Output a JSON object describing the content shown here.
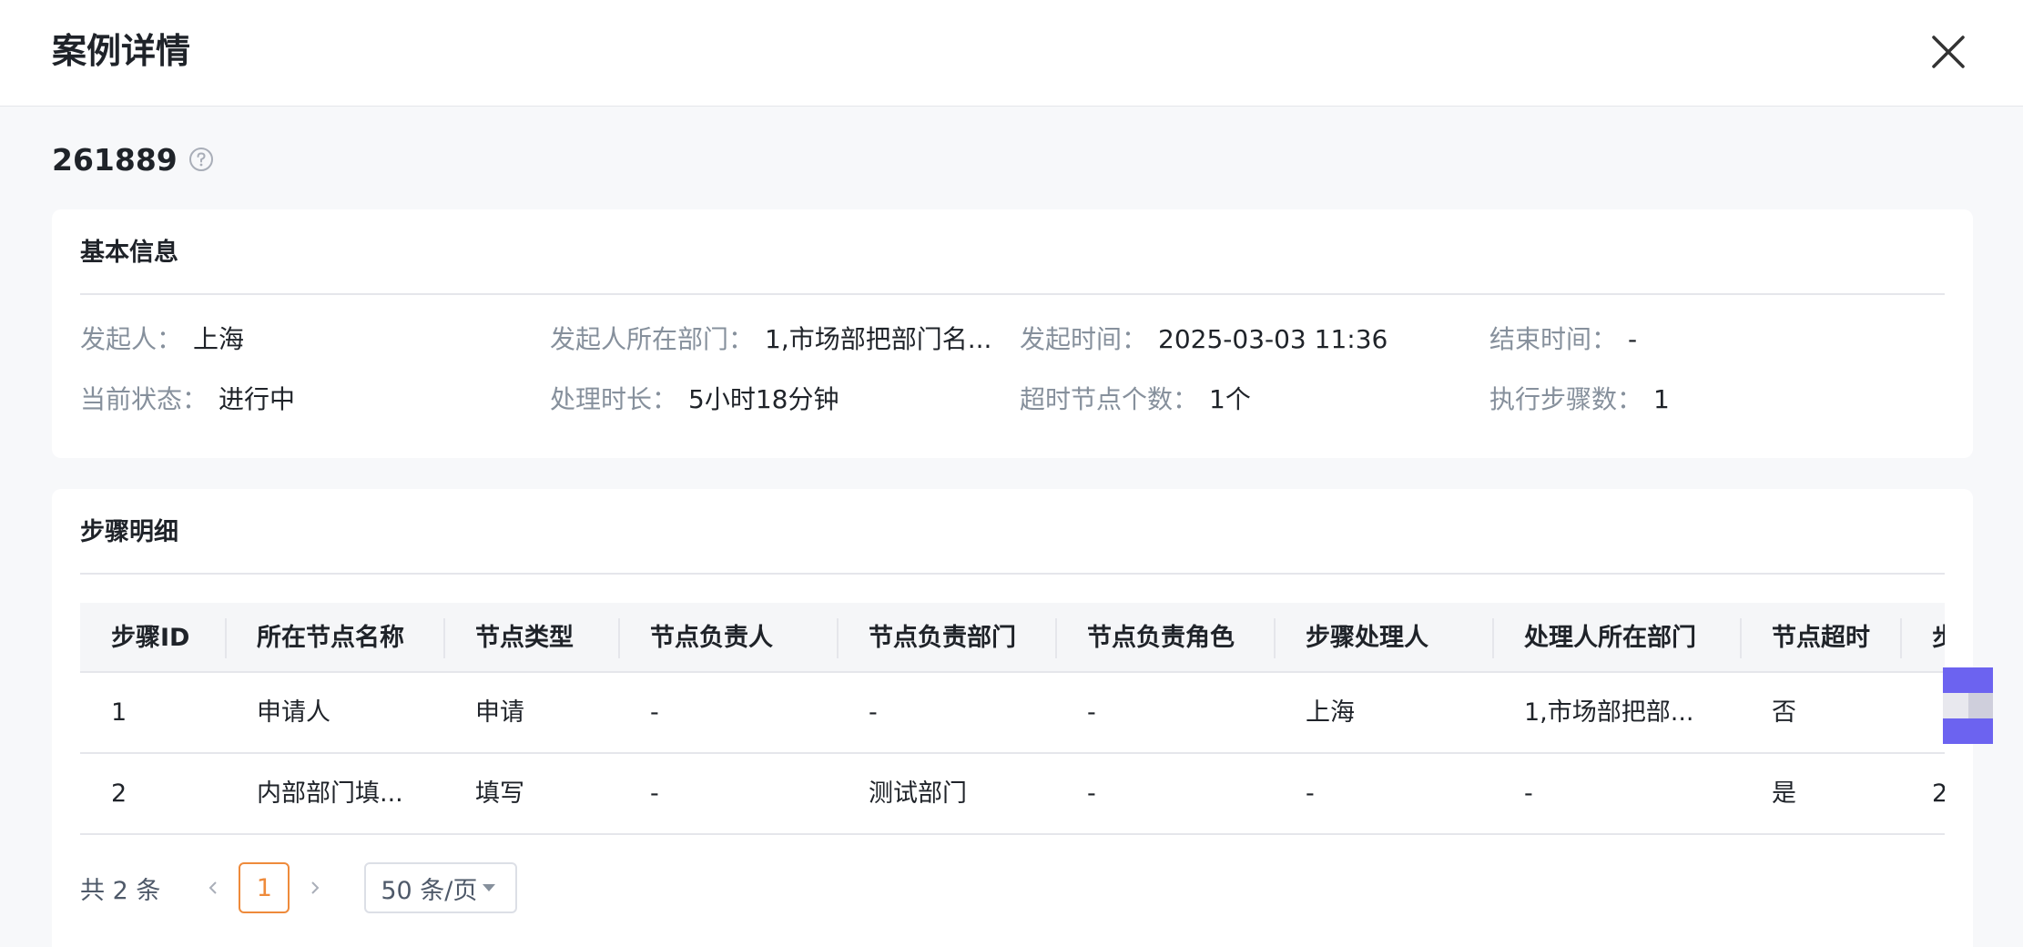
{
  "header": {
    "title": "案例详情"
  },
  "case": {
    "id": "261889"
  },
  "basic_info": {
    "title": "基本信息",
    "fields": [
      {
        "label": "发起人：",
        "value": "上海"
      },
      {
        "label": "发起人所在部门：",
        "value": "1,市场部把部门名..."
      },
      {
        "label": "发起时间：",
        "value": "2025-03-03 11:36"
      },
      {
        "label": "结束时间：",
        "value": "-"
      },
      {
        "label": "当前状态：",
        "value": "进行中"
      },
      {
        "label": "处理时长：",
        "value": "5小时18分钟"
      },
      {
        "label": "超时节点个数：",
        "value": "1个"
      },
      {
        "label": "执行步骤数：",
        "value": "1"
      }
    ]
  },
  "steps": {
    "title": "步骤明细",
    "columns": [
      "步骤ID",
      "所在节点名称",
      "节点类型",
      "节点负责人",
      "节点负责部门",
      "节点负责角色",
      "步骤处理人",
      "处理人所在部门",
      "节点超时",
      "步"
    ],
    "rows": [
      [
        "1",
        "申请人",
        "申请",
        "-",
        "-",
        "-",
        "上海",
        "1,市场部把部...",
        "否",
        ""
      ],
      [
        "2",
        "内部部门填...",
        "填写",
        "-",
        "测试部门",
        "-",
        "-",
        "-",
        "是",
        "2"
      ]
    ]
  },
  "pagination": {
    "total_text": "共 2 条",
    "current_page": "1",
    "page_size": "50 条/页"
  },
  "colors": {
    "accent": "#ee8a3b",
    "widget": "#6c63f0"
  }
}
